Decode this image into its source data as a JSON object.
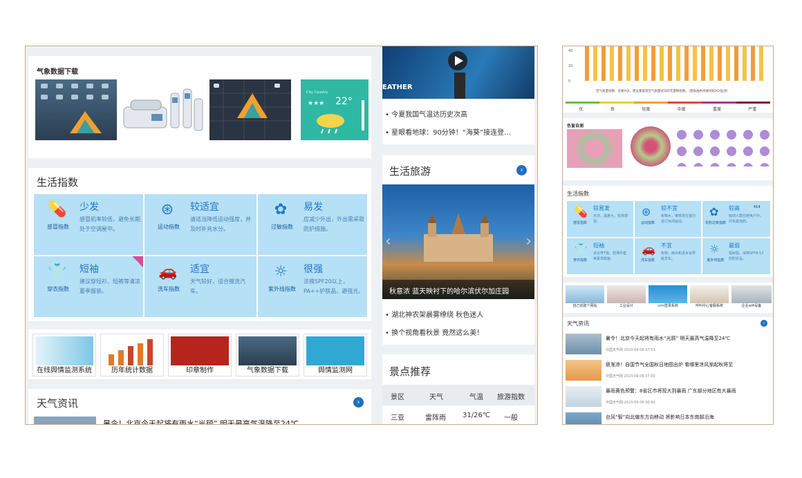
{
  "left": {
    "weather_download": {
      "title": "气象数据下载"
    },
    "video_news": [
      "今夏我国气温达历史次高",
      "星眼看地球：90分钟！“海葵”接连登…"
    ],
    "video_text": "EATHER",
    "life_index": {
      "title": "生活指数",
      "items": [
        {
          "name": "感冒指数",
          "level": "少发",
          "desc": "感冒机率较低，避免长期处于空调屋中。"
        },
        {
          "name": "运动指数",
          "level": "较适宜",
          "desc": "请适当降低运动强度，并及时补充水分。"
        },
        {
          "name": "过敏指数",
          "level": "易发",
          "desc": "应减少外出，外出需采取防护措施。"
        },
        {
          "name": "穿衣指数",
          "level": "短袖",
          "desc": "建议穿短衫、短裤等清凉夏季服装。"
        },
        {
          "name": "洗车指数",
          "level": "适宜",
          "desc": "天气较好，适合擦洗汽车。"
        },
        {
          "name": "紫外线指数",
          "level": "很强",
          "desc": "涂擦SPF20以上，PA++护肤品，避强光。"
        }
      ]
    },
    "travel": {
      "title": "生活旅游",
      "caption": "秋意浓 蓝天映衬下的哈尔滨伏尔加庄园",
      "news": [
        "湖北神农架晨雾缭绕 秋色迷人",
        "换个视角看秋景 竟然这么美！"
      ]
    },
    "tools": [
      "在线舆情监测系统",
      "历年统计数据",
      "印章制作",
      "气象数据下载",
      "舆情监测网"
    ],
    "weather_news": {
      "title": "天气资讯",
      "cut_text": "暑令！北京今天起将有雨水“光顾” 明天最高气温降至24℃"
    },
    "scenic": {
      "title": "景点推荐",
      "headers": [
        "景区",
        "天气",
        "气温",
        "旅游指数"
      ],
      "rows": [
        [
          "三亚",
          "雷阵雨",
          "31/26℃",
          "一般"
        ]
      ]
    },
    "weather_card_temp": "22°",
    "weather_card_city": "City Country"
  },
  "right": {
    "aqi": {
      "y_ticks": [
        "40",
        "20",
        "0"
      ],
      "note": "空气质量指数：首要AQI，建议重度或空气质量状况的无量纲指数。（图表由各地收到的AQI监测）",
      "levels": [
        "优",
        "良",
        "轻度",
        "中度",
        "重度",
        "严重"
      ],
      "level_colors": [
        "#6cbf3f",
        "#e9d13a",
        "#f29d3a",
        "#e8453c",
        "#9b3f8f",
        "#7a1f2b"
      ]
    },
    "color_blind": {
      "title": "色盲自测"
    },
    "life_index": {
      "title": "生活指数",
      "items": [
        {
          "name": "感冒指数",
          "level": "较易发",
          "desc": "天凉，温差大，较易感冒。"
        },
        {
          "name": "运动指数",
          "level": "较不宜",
          "desc": "有降水，推荐您在室内进行休闲运动。"
        },
        {
          "name": "花粉过敏指数",
          "level": "较高",
          "extra": "414",
          "desc": "敏感人群应避免户外，并有其他药。"
        },
        {
          "name": "穿衣指数",
          "level": "短袖",
          "desc": "适合穿T恤、短薄外套等夏季服装。"
        },
        {
          "name": "洗车指数",
          "level": "不宜",
          "desc": "有雨，雨水和泥水会弄脏爱车。"
        },
        {
          "name": "紫外线指数",
          "level": "最弱",
          "desc": "辐射弱，涂擦SPF8-12的防护品。"
        }
      ]
    },
    "tools": [
      "自己创建个网站",
      "工业设计",
      "crm登录系统",
      "呼叫中心客服系统",
      "企业wifi设备"
    ],
    "news": {
      "title": "天气资讯",
      "items": [
        {
          "title": "暑令！北京今天起将有雨水“光顾” 明天最高气温降至24℃",
          "date": "中国天气网 2023-09-08 07:53"
        },
        {
          "title": "疲渐凉！自国节气全国秋日地图出炉 看哪里凉风渐起秋将至",
          "date": "中国天气网 2023-09-08 07:00"
        },
        {
          "title": "暴雨黄色预警：8省区市将现大到暴雨 广东部分地区有大暴雨",
          "date": "中国天气网 2023-09-08 06:49"
        },
        {
          "title": "台风“智”向北偏东方向移动 将影响日本东南部沿海",
          "date": ""
        }
      ]
    }
  }
}
